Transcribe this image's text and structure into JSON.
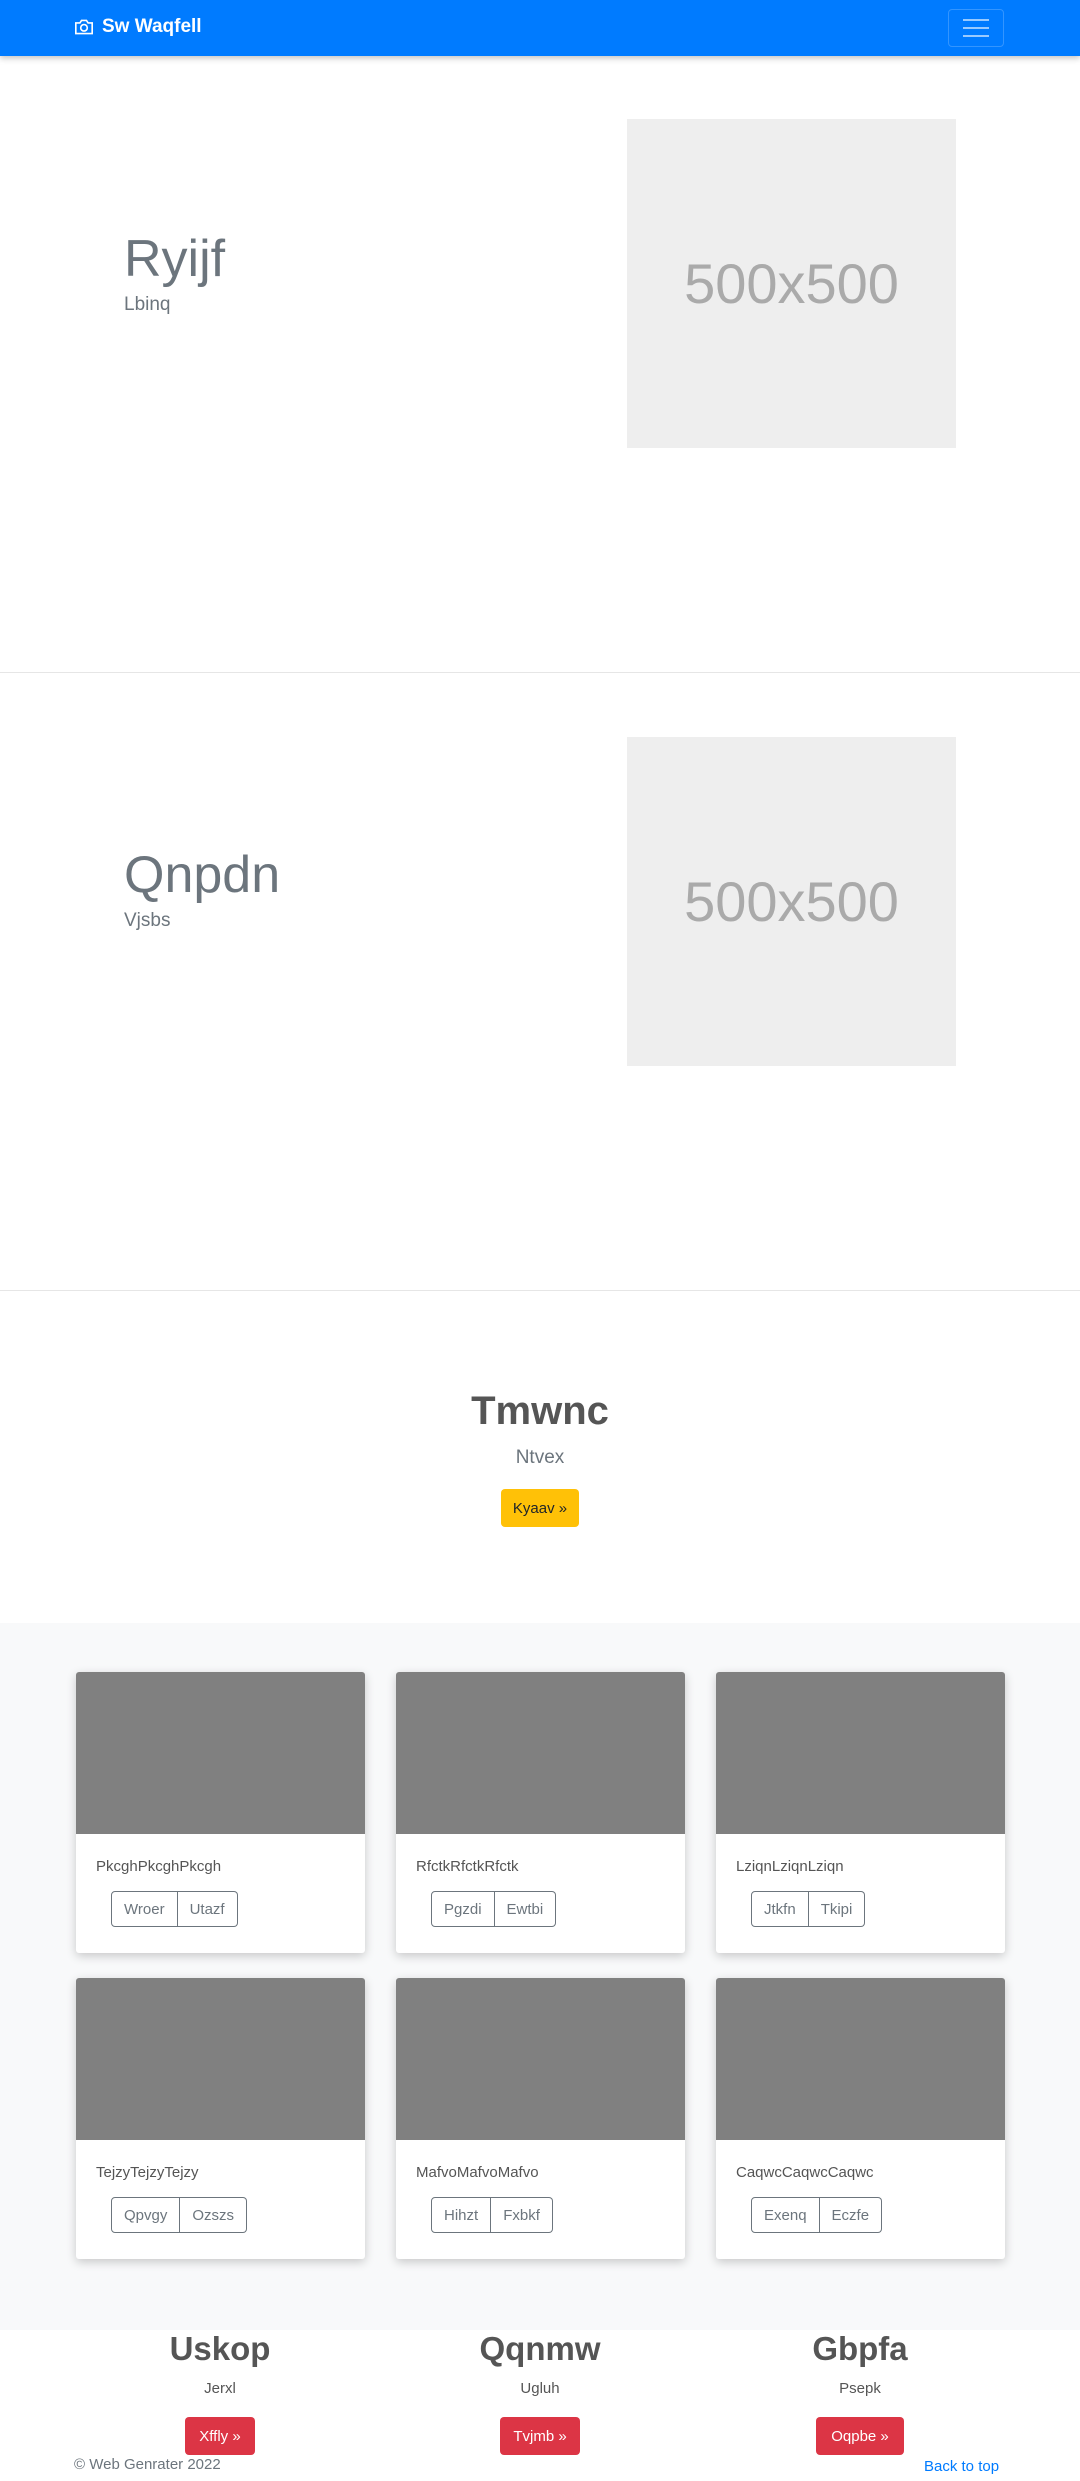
{
  "navbar": {
    "brand": "Sw Waqfell",
    "brand_icon": "camera-icon",
    "toggle_icon": "hamburger-icon"
  },
  "hero_sections": [
    {
      "title": "Ryijf",
      "subtitle": "Lbinq",
      "placeholder": "500x500"
    },
    {
      "title": "Qnpdn",
      "subtitle": "Vjsbs",
      "placeholder": "500x500"
    }
  ],
  "jumbotron": {
    "title": "Tmwnc",
    "subtitle": "Ntvex",
    "button": "Kyaav »"
  },
  "cards": [
    {
      "text": "PkcghPkcghPkcgh",
      "btn1": "Wroer",
      "btn2": "Utazf"
    },
    {
      "text": "RfctkRfctkRfctk",
      "btn1": "Pgzdi",
      "btn2": "Ewtbi"
    },
    {
      "text": "LziqnLziqnLziqn",
      "btn1": "Jtkfn",
      "btn2": "Tkipi"
    },
    {
      "text": "TejzyTejzyTejzy",
      "btn1": "Qpvgy",
      "btn2": "Ozszs"
    },
    {
      "text": "MafvoMafvoMafvo",
      "btn1": "Hihzt",
      "btn2": "Fxbkf"
    },
    {
      "text": "CaqwcCaqwcCaqwc",
      "btn1": "Exenq",
      "btn2": "Eczfe"
    }
  ],
  "columns": [
    {
      "heading": "Uskop",
      "text": "Jerxl",
      "button": "Xffly »"
    },
    {
      "heading": "Qqnmw",
      "text": "Ugluh",
      "button": "Tvjmb »"
    },
    {
      "heading": "Gbpfa",
      "text": "Psepk",
      "button": "Oqpbe »"
    }
  ],
  "footer": {
    "copyright": "© Web Genrater 2022",
    "back_to_top": "Back to top"
  },
  "colors": {
    "primary": "#007bff",
    "warning": "#ffc107",
    "danger": "#dc3545",
    "album_bg": "#f8f9fa"
  }
}
